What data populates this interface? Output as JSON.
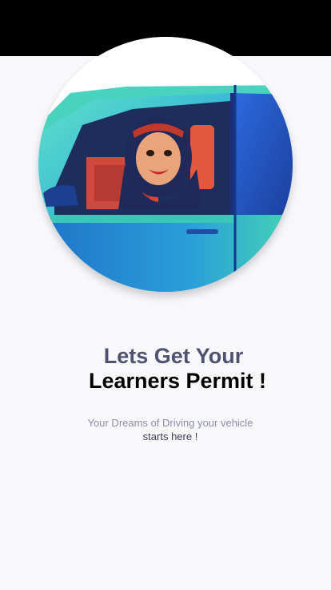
{
  "colors": {
    "status_bar": "#000000",
    "background": "#f8f8fb",
    "headline_primary": "#4f5270",
    "headline_secondary": "#000000",
    "subtitle_muted": "#8a8ea8",
    "subtitle_dark": "#3b3d54"
  },
  "hero": {
    "image_icon": "woman-driving-car-illustration"
  },
  "headline": {
    "line1": "Lets Get Your",
    "line2": "Learners Permit !"
  },
  "subtitle": {
    "line1": "Your Dreams of Driving your vehicle",
    "line2": "starts here !"
  }
}
